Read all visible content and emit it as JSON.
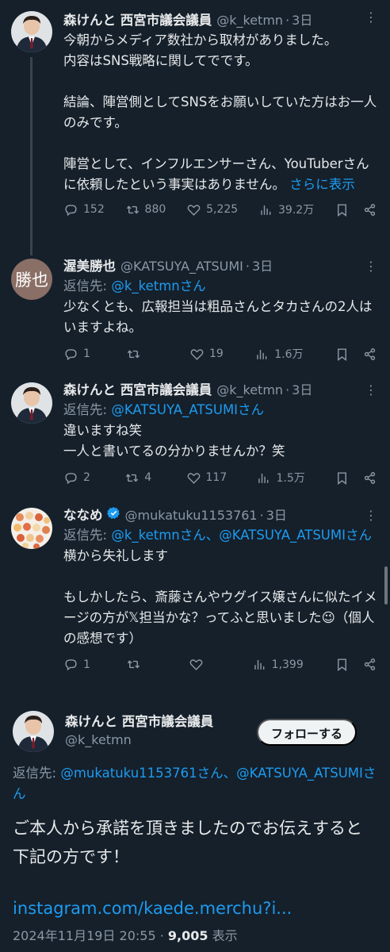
{
  "tweets": [
    {
      "name": "森けんと 西宮市議会議員",
      "handle": "@k_ketmn",
      "time": "3日",
      "text": "今朝からメディア数社から取材がありました。\n内容はSNS戦略に関してでです。\n\n結論、陣営側としてSNSをお願いしていた方はお一人のみです。\n\n陣営として、インフルエンサーさん、YouTuberさんに依頼したという事実はありません。",
      "show_more": "さらに表示",
      "replies": "152",
      "retweets": "880",
      "likes": "5,225",
      "views": "39.2万"
    },
    {
      "name": "渥美勝也",
      "handle": "@KATSUYA_ATSUMI",
      "time": "3日",
      "avatar_text": "勝也",
      "reply_prefix": "返信先: ",
      "reply_to": "@k_ketmnさん",
      "text": "少なくとも、広報担当は粗品さんとタカさんの2人はいますよね。",
      "replies": "1",
      "retweets": "",
      "likes": "19",
      "views": "1.6万"
    },
    {
      "name": "森けんと 西宮市議会議員",
      "handle": "@k_ketmn",
      "time": "3日",
      "reply_prefix": "返信先: ",
      "reply_to": "@KATSUYA_ATSUMIさん",
      "text": "違いますね笑\n一人と書いてるの分かりませんか？笑",
      "replies": "2",
      "retweets": "4",
      "likes": "117",
      "views": "1.5万"
    },
    {
      "name": "ななめ",
      "handle": "@mukatuku1153761",
      "time": "3日",
      "reply_prefix": "返信先: ",
      "reply_to": "@k_ketmnさん、@KATSUYA_ATSUMIさん",
      "text": "横から失礼します\n\nもしかしたら、斎藤さんやウグイス嬢さんに似たイメージの方が𝕏担当かな？ってふと思いました😉（個人の感想です）",
      "replies": "1",
      "retweets": "",
      "likes": "",
      "views": "1,399"
    }
  ],
  "focus": {
    "name": "森けんと 西宮市議会議員",
    "handle": "@k_ketmn",
    "follow_label": "フォローする",
    "reply_prefix": "返信先: ",
    "reply_to": "@mukatuku1153761さん、@KATSUYA_ATSUMIさん",
    "text": "ご本人から承諾を頂きましたのでお伝えすると下記の方です！",
    "link": "instagram.com/kaede.merchu?i...",
    "date": "2024年11月19日 20:55",
    "sep": " · ",
    "views_count": "9,005",
    "views_label": " 表示"
  },
  "colors": {
    "background": "#15202b",
    "link": "#1d9bf0",
    "muted": "#8b98a5",
    "verified": "#1d9bf0"
  },
  "icons": [
    "reply-icon",
    "retweet-icon",
    "like-icon",
    "views-icon",
    "bookmark-icon",
    "share-icon",
    "more-icon",
    "verified-icon"
  ]
}
